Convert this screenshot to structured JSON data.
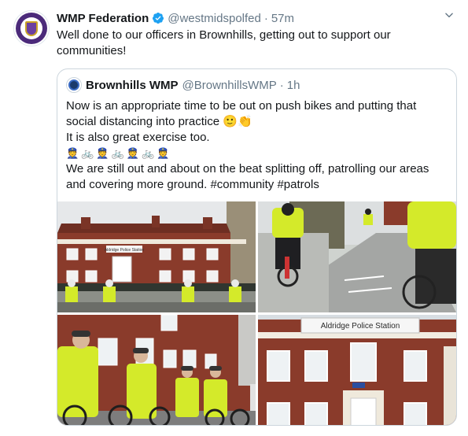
{
  "tweet": {
    "author_name": "WMP Federation",
    "author_handle": "@westmidspolfed",
    "separator": "·",
    "time": "57m",
    "text": "Well done to our officers in Brownhills, getting out to support our communities!"
  },
  "quoted": {
    "author_name": "Brownhills WMP",
    "author_handle": "@BrownhillsWMP",
    "separator": "·",
    "time": "1h",
    "line1": "Now is an appropriate time to be out on push bikes and putting that social distancing into practice 🙂👏",
    "line2": "It is also great exercise too.",
    "emoji_row": [
      "👮",
      "🚲",
      "👮",
      "🚲",
      "👮",
      "🚲",
      "👮"
    ],
    "line3": "We are still out and about on the beat splitting off, patrolling our areas and covering more ground. #community #patrols",
    "photos": {
      "p4_sign": "Aldridge Police Station",
      "p1_sign": "Aldridge Police Station"
    }
  },
  "colors": {
    "verified": "#1da1f2",
    "muted": "#657786",
    "hi_vis": "#d4ea2a",
    "brick": "#8a3b2b"
  },
  "icons": {
    "verified": "verified-badge-icon",
    "caret": "chevron-down-icon"
  }
}
